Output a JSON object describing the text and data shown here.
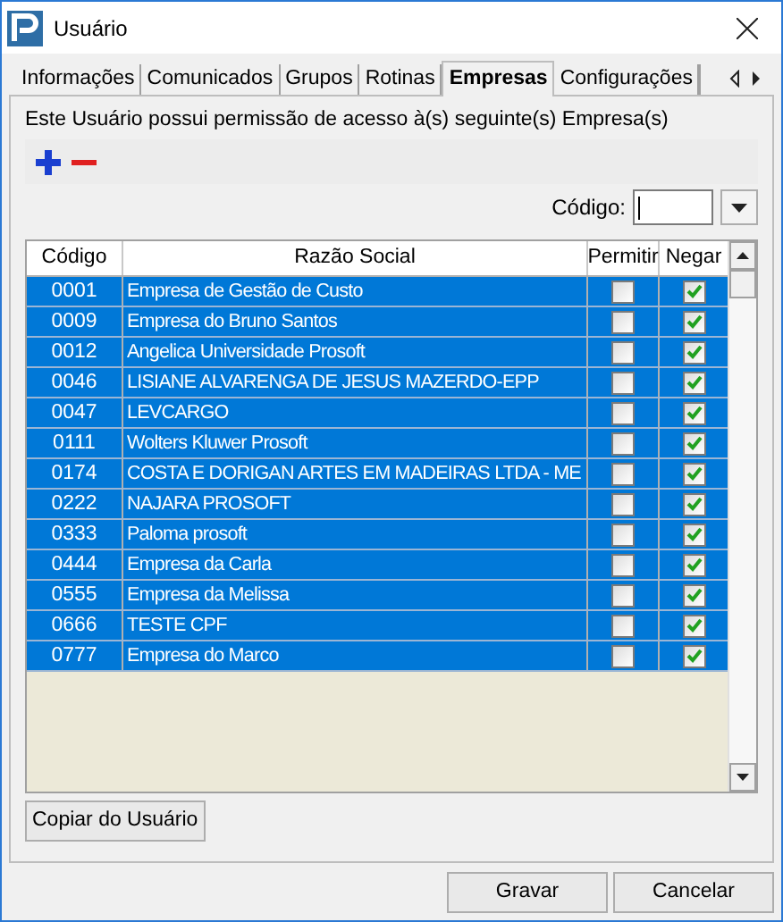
{
  "window": {
    "title": "Usuário"
  },
  "tabs": [
    {
      "label": "Informações",
      "selected": false
    },
    {
      "label": "Comunicados",
      "selected": false
    },
    {
      "label": "Grupos",
      "selected": false
    },
    {
      "label": "Rotinas",
      "selected": false
    },
    {
      "label": "Empresas",
      "selected": true
    },
    {
      "label": "Configurações",
      "selected": false
    }
  ],
  "description": "Este Usuário possui permissão de acesso à(s) seguinte(s) Empresa(s)",
  "code_filter": {
    "label": "Código:"
  },
  "table": {
    "columns": [
      "Código",
      "Razão Social",
      "Permitir",
      "Negar"
    ],
    "rows": [
      {
        "codigo": "0001",
        "razao": "Empresa de Gestão de Custo",
        "permitir": false,
        "negar": true,
        "selected": true
      },
      {
        "codigo": "0009",
        "razao": "Empresa do Bruno Santos",
        "permitir": false,
        "negar": true,
        "selected": true
      },
      {
        "codigo": "0012",
        "razao": "Angelica Universidade Prosoft",
        "permitir": false,
        "negar": true,
        "selected": true
      },
      {
        "codigo": "0046",
        "razao": "LISIANE ALVARENGA DE JESUS MAZERDO-EPP",
        "permitir": false,
        "negar": true,
        "selected": true
      },
      {
        "codigo": "0047",
        "razao": "LEVCARGO",
        "permitir": false,
        "negar": true,
        "selected": true
      },
      {
        "codigo": "0111",
        "razao": "Wolters Kluwer Prosoft",
        "permitir": false,
        "negar": true,
        "selected": true
      },
      {
        "codigo": "0174",
        "razao": "COSTA E DORIGAN ARTES EM MADEIRAS LTDA - ME",
        "permitir": false,
        "negar": true,
        "selected": true
      },
      {
        "codigo": "0222",
        "razao": "NAJARA PROSOFT",
        "permitir": false,
        "negar": true,
        "selected": true
      },
      {
        "codigo": "0333",
        "razao": "Paloma prosoft",
        "permitir": false,
        "negar": true,
        "selected": true
      },
      {
        "codigo": "0444",
        "razao": "Empresa da Carla",
        "permitir": false,
        "negar": true,
        "selected": true
      },
      {
        "codigo": "0555",
        "razao": "Empresa da Melissa",
        "permitir": false,
        "negar": true,
        "selected": true
      },
      {
        "codigo": "0666",
        "razao": "TESTE CPF",
        "permitir": false,
        "negar": true,
        "selected": true
      },
      {
        "codigo": "0777",
        "razao": "Empresa do Marco",
        "permitir": false,
        "negar": true,
        "selected": true
      }
    ]
  },
  "copy_button": "Copiar do Usuário",
  "buttons": [
    "Gravar",
    "Cancelar"
  ]
}
